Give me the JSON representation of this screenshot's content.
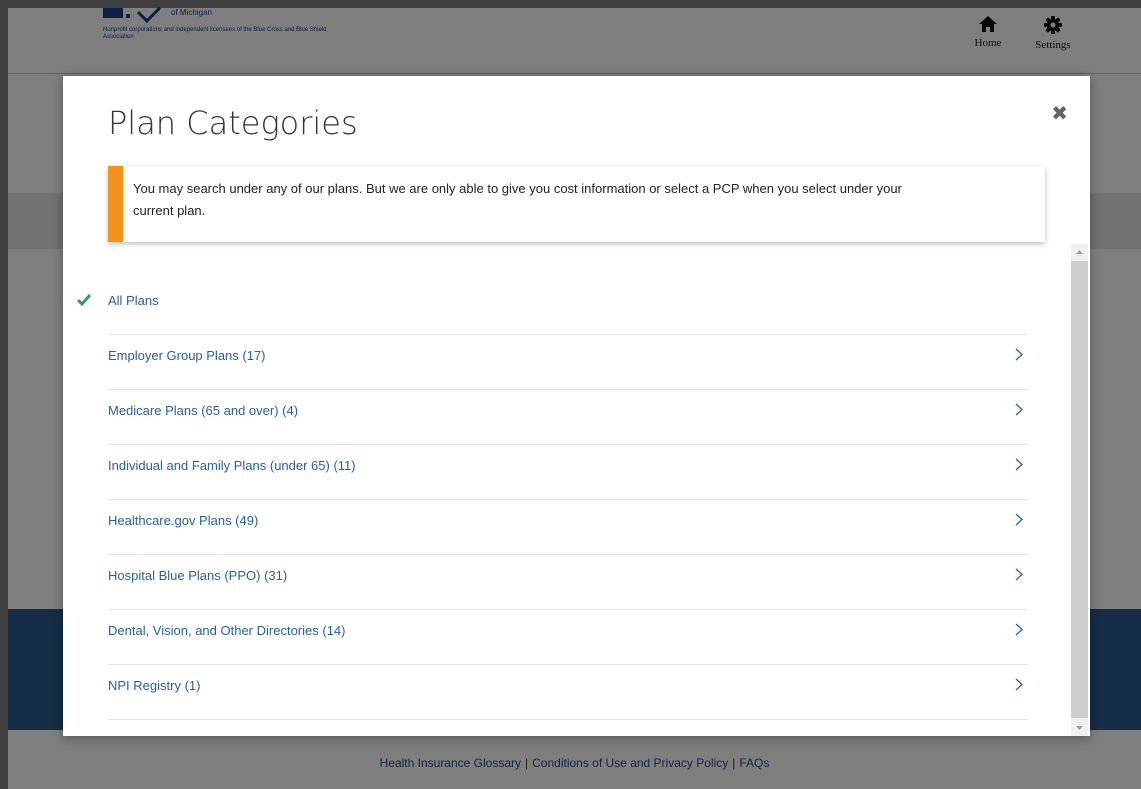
{
  "header": {
    "logo_subtitle": "of Michigan",
    "logo_tagline": "Nonprofit corporations and independent licensees of the Blue Cross and Blue Shield Association",
    "home_label": "Home",
    "settings_label": "Settings"
  },
  "modal": {
    "title": "Plan Categories",
    "close_glyph": "✖",
    "notice": "You may search under any of our plans. But we are only able to give you cost information or select a PCP when you select under your current plan.",
    "items": [
      {
        "label": "All Plans",
        "selected": true
      },
      {
        "label": "Employer Group Plans (17)"
      },
      {
        "label": "Medicare Plans (65 and over) (4)"
      },
      {
        "label": "Individual and Family Plans (under 65) (11)"
      },
      {
        "label": "Healthcare.gov Plans (49)"
      },
      {
        "label": "Hospital Blue Plans (PPO) (31)"
      },
      {
        "label": "Dental, Vision, and Other Directories (14)"
      },
      {
        "label": "NPI Registry (1)"
      }
    ]
  },
  "footer": {
    "links": [
      "Health Insurance Glossary",
      "Conditions of Use and Privacy Policy",
      "FAQs"
    ],
    "separator": "|"
  },
  "colors": {
    "accent_orange": "#f5921e",
    "link_blue": "#2a6098",
    "check_green": "#3a9a5b",
    "brand_blue": "#1b3f8b"
  }
}
